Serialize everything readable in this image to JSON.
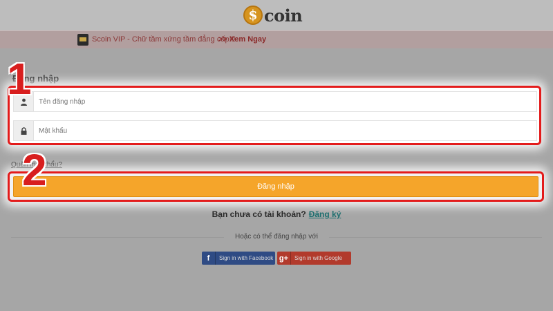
{
  "header": {
    "logo_mark": "$",
    "logo_text": "coin"
  },
  "promo": {
    "text": "Scoin VIP - Chữ tầm xứng tầm đẳng cấp!!!",
    "link": ">> Xem Ngay"
  },
  "annotations": {
    "step1": "1",
    "step2": "2"
  },
  "login": {
    "title": "Đăng nhập",
    "username_placeholder": "Tên đăng nhập",
    "password_placeholder": "Mật khẩu",
    "forgot": "Quên mật khẩu?",
    "submit": "Đăng nhập"
  },
  "register": {
    "prompt": "Bạn chưa có tài khoản?",
    "link": "Đăng ký"
  },
  "social": {
    "or_text": "Hoặc có thể đăng nhập với",
    "facebook_icon": "f",
    "facebook": "Sign in with Facebook",
    "google_icon": "g+",
    "google": "Sign in with Google"
  },
  "colors": {
    "accent": "#f5a52a",
    "highlight": "#e31b1b",
    "facebook": "#2f4b84",
    "google": "#b23a2c"
  }
}
